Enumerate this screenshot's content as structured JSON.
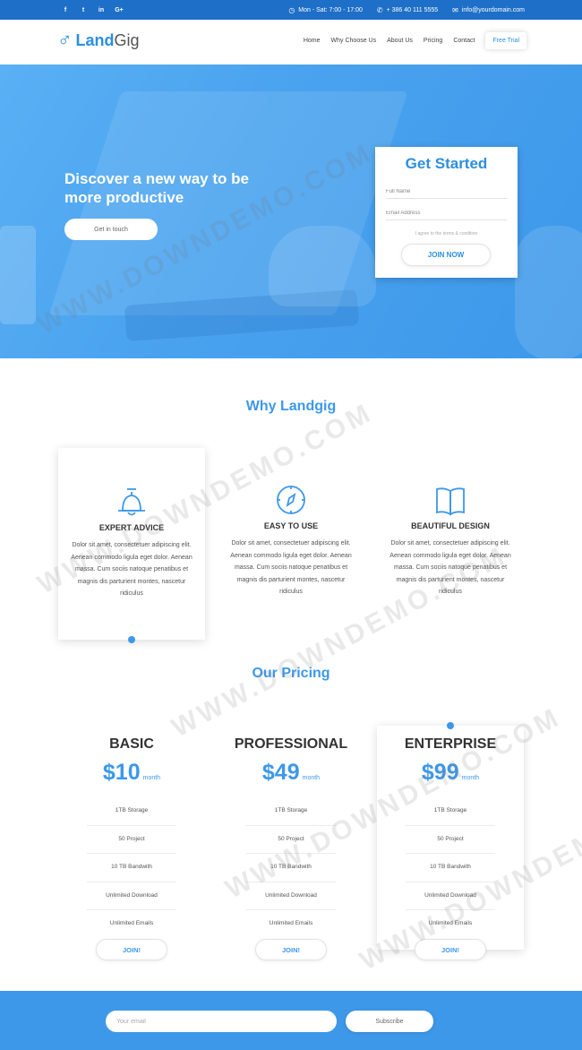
{
  "topbar": {
    "socials": [
      "f",
      "t",
      "in",
      "G+"
    ],
    "hours": "Mon - Sat: 7:00 - 17:00",
    "phone": "+ 386 40 111 5555",
    "email": "info@yourdomain.com"
  },
  "brand": {
    "name_bold": "Land",
    "name_light": "Gig"
  },
  "nav": [
    "Home",
    "Why Choose Us",
    "About Us",
    "Pricing",
    "Contact"
  ],
  "nav_cta": "Free Trial",
  "hero": {
    "title": "Discover a new way to be more productive",
    "button": "Get in touch"
  },
  "signup_form": {
    "title": "Get Started",
    "name_placeholder": "Full Name",
    "email_placeholder": "Email Address",
    "terms": "I agree to the terms & condition",
    "submit": "JOIN NOW"
  },
  "why": {
    "title": "Why Landgig",
    "features": [
      {
        "icon": "bell-icon",
        "title": "EXPERT ADVICE",
        "text": "Dolor sit amet, consectetuer adipiscing elit. Aenean commodo ligula eget dolor. Aenean massa. Cum sociis natoque penatibus et magnis dis parturient montes, nascetur ridiculus"
      },
      {
        "icon": "compass-icon",
        "title": "EASY TO USE",
        "text": "Dolor sit amet, consectetuer adipiscing elit. Aenean commodo ligula eget dolor. Aenean massa. Cum sociis natoque penatibus et magnis dis parturient montes, nascetur ridiculus"
      },
      {
        "icon": "book-icon",
        "title": "BEAUTIFUL DESIGN",
        "text": "Dolor sit amet, consectetuer adipiscing elit. Aenean commodo ligula eget dolor. Aenean massa. Cum sociis natoque penatibus et magnis dis parturient montes, nascetur ridiculus"
      }
    ]
  },
  "pricing": {
    "title": "Our Pricing",
    "plans": [
      {
        "name": "BASIC",
        "price": "$10",
        "period": "month",
        "features": [
          "1TB Storage",
          "50 Project",
          "10 TB Bandwith",
          "Unlimited Download",
          "Unlimited Emails"
        ],
        "button": "JOIN!"
      },
      {
        "name": "PROFESSIONAL",
        "price": "$49",
        "period": "month",
        "features": [
          "1TB Storage",
          "50 Project",
          "10 TB Bandwith",
          "Unlimited Download",
          "Unlimited Emails"
        ],
        "button": "JOIN!"
      },
      {
        "name": "ENTERPRISE",
        "price": "$99",
        "period": "month",
        "features": [
          "1TB Storage",
          "50 Project",
          "10 TB Bandwith",
          "Unlimited Download",
          "Unlimited Emails"
        ],
        "button": "JOIN!"
      }
    ]
  },
  "subscribe": {
    "placeholder": "Your email",
    "button": "Subscribe"
  },
  "watermark": "WWW.DOWNDEMO.COM",
  "colors": {
    "primary": "#3d98ea",
    "topbar": "#1e6fc7",
    "hero": "#4aa3ef"
  }
}
